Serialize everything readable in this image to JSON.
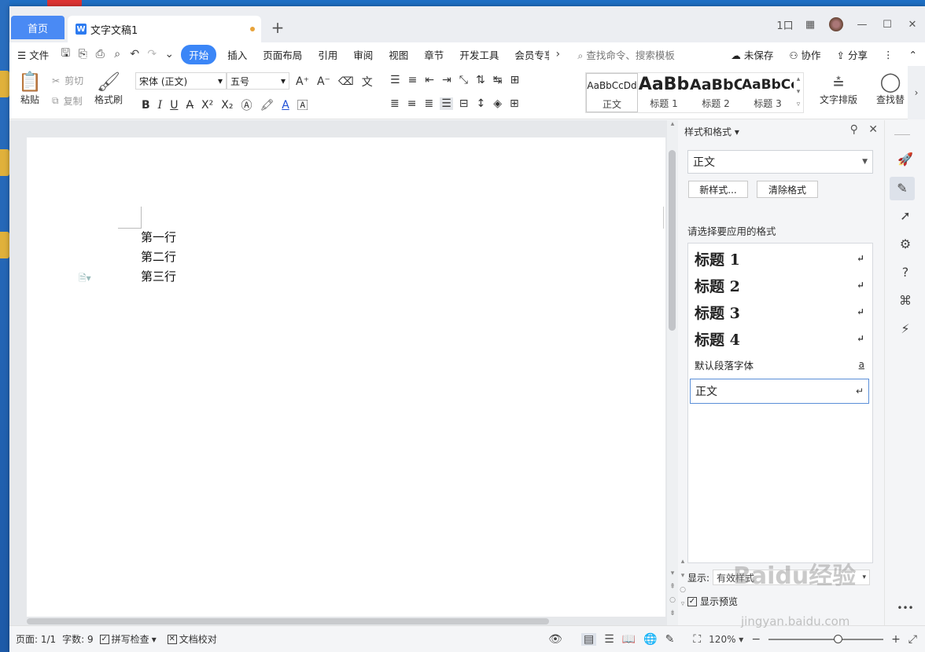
{
  "tabs": {
    "home": "首页",
    "doc": "文字文稿1",
    "add": "+"
  },
  "window_controls": [
    "1口",
    "88",
    "—",
    "☐",
    "✕"
  ],
  "menu": {
    "file": "文件",
    "items": [
      "开始",
      "插入",
      "页面布局",
      "引用",
      "审阅",
      "视图",
      "章节",
      "开发工具",
      "会员专享"
    ],
    "search": "查找命令、搜索模板",
    "unsaved": "未保存",
    "collab": "协作",
    "share": "分享"
  },
  "ribbon": {
    "paste": "粘贴",
    "cut": "剪切",
    "copy": "复制",
    "format_painter": "格式刷",
    "font_name": "宋体 (正文)",
    "font_size": "五号",
    "gallery": [
      {
        "sample": "AaBbCcDd",
        "label": "正文"
      },
      {
        "sample": "AaBb",
        "label": "标题 1"
      },
      {
        "sample": "AaBbC",
        "label": "标题 2"
      },
      {
        "sample": "AaBbCc",
        "label": "标题 3"
      }
    ],
    "text_layout": "文字排版",
    "find_replace": "查找替"
  },
  "document": {
    "lines": [
      "第一行",
      "第二行",
      "第三行"
    ]
  },
  "pane": {
    "title": "样式和格式",
    "current_style": "正文",
    "new_style": "新样式...",
    "clear_format": "清除格式",
    "subtitle": "请选择要应用的格式",
    "styles": [
      {
        "name": "标题  1",
        "mark": "↵"
      },
      {
        "name": "标题  2",
        "mark": "↵"
      },
      {
        "name": "标题  3",
        "mark": "↵"
      },
      {
        "name": "标题  4",
        "mark": "↵"
      },
      {
        "name": "默认段落字体",
        "mark": "a"
      },
      {
        "name": "正文",
        "mark": "↵"
      }
    ],
    "show_label": "显示:",
    "show_value": "有效样式",
    "preview_label": "显示预览",
    "preview_checked": true
  },
  "status": {
    "page": "页面: 1/1",
    "words": "字数: 9",
    "spell": "拼写检查",
    "proof": "文档校对",
    "zoom": "120%",
    "zoom_level_percent": 60
  },
  "watermark": {
    "text": "Baidu经验",
    "url": "jingyan.baidu.com"
  }
}
